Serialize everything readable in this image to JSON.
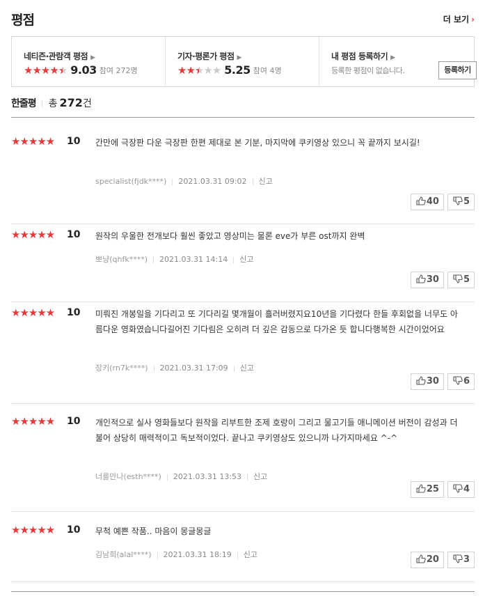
{
  "header": {
    "title": "평점",
    "more_label": "더 보기"
  },
  "summary": {
    "netizen": {
      "title": "네티즌·관람객 평점",
      "score": "9.03",
      "participants": "참여 272명",
      "rating_out_of_5": 4.5
    },
    "critic": {
      "title": "기자·평론가 평점",
      "score": "5.25",
      "participants": "참여 4명",
      "rating_out_of_5": 2.5
    },
    "mine": {
      "title": "내 평점 등록하기",
      "empty_text": "등록한 평점이 없습니다.",
      "button_label": "등록하기"
    }
  },
  "list_header": {
    "label": "한줄평",
    "total_prefix": "총",
    "total_count": "272",
    "total_unit": "건"
  },
  "reviews": [
    {
      "score": "10",
      "stars": 5,
      "text": "간만에 극장판 다운 극장판 한편 제대로 본 기분, 마지막에 쿠키영상 있으니 꼭 끝까지 보시길!",
      "user": "specialist(fjdk****)",
      "date": "2021.03.31 09:02",
      "report": "신고",
      "likes": "40",
      "dislikes": "5"
    },
    {
      "score": "10",
      "stars": 5,
      "text": "원작의 우울한 전개보다 훨씬 좋았고 영상미는 물론 eve가 부른 ost까지 완벽",
      "user": "뽀냥(qhfk****)",
      "date": "2021.03.31 14:14",
      "report": "신고",
      "likes": "30",
      "dislikes": "5"
    },
    {
      "score": "10",
      "stars": 5,
      "text": "미뤄진 개봉일을 기다리고 또 기다리길 몇개월이 흘러버렸지요10년을 기다렸다 한들 후회없을 너무도 아름다운 영화였습니다길어진 기다림은 오히려 더 깊은 감동으로 다가온 듯 합니다행복한 시간이었어요",
      "user": "장키(rn7k****)",
      "date": "2021.03.31 17:09",
      "report": "신고",
      "likes": "30",
      "dislikes": "6"
    },
    {
      "score": "10",
      "stars": 5,
      "text": "개인적으로 실사 영화들보다 원작을 리부트한 조제 호랑이 그리고 물고기들 애니메이션 버전이 감성과 더불어 상당히 매력적이고 독보적이었다. 끝나고 쿠키영상도 있으니까 나가지마세요 ^-^",
      "user": "너를만나(esth****)",
      "date": "2021.03.31 13:53",
      "report": "신고",
      "likes": "25",
      "dislikes": "4"
    },
    {
      "score": "10",
      "stars": 5,
      "text": "무척 예쁜 작품.. 마음이 몽글몽글",
      "user": "김남희(alal****)",
      "date": "2021.03.31 18:19",
      "report": "신고",
      "likes": "20",
      "dislikes": "3"
    }
  ],
  "icons": {
    "thumb_up": "thumbs-up-icon",
    "thumb_down": "thumbs-down-icon",
    "star": "star-icon"
  },
  "colors": {
    "accent": "#e8393b",
    "star_off": "#cccccc"
  }
}
